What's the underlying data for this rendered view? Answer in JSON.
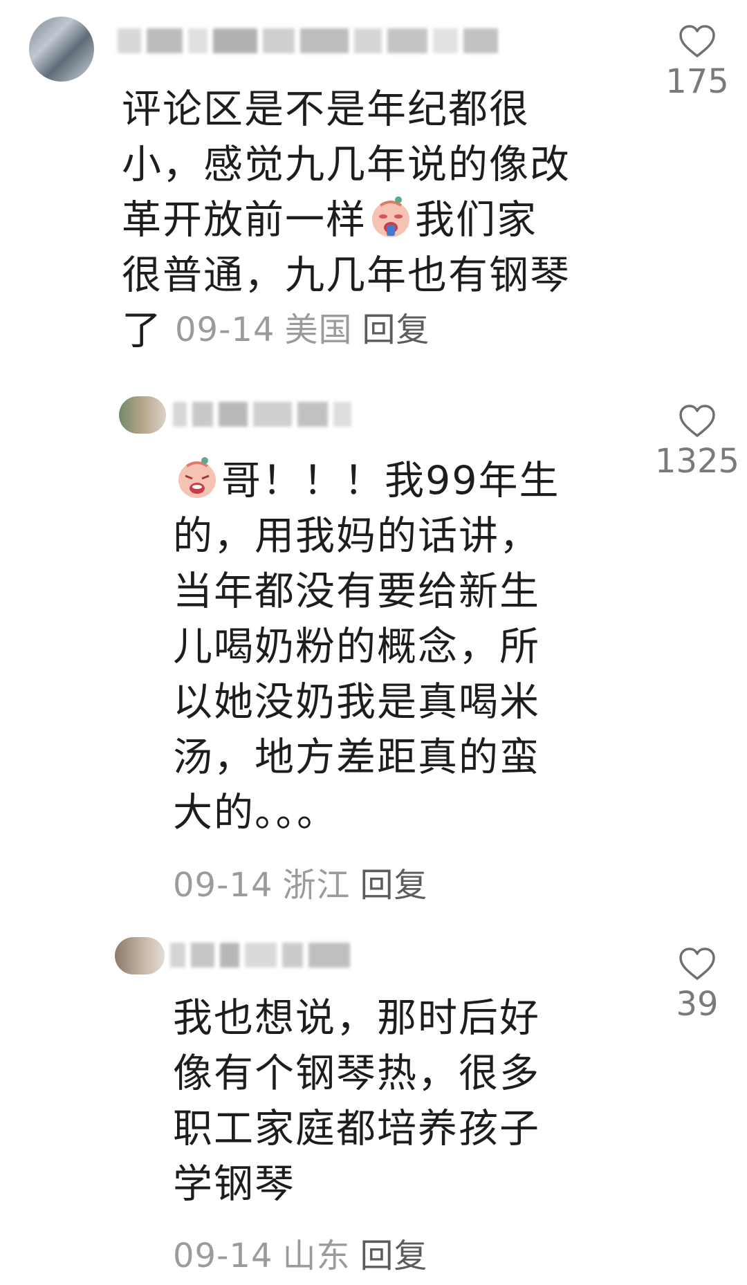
{
  "comments": [
    {
      "text_lines": [
        "评论区是不是年纪都很",
        "小，感觉九几年说的像改",
        "革开放前一样",
        "我们家",
        "很普通，九几年也有钢琴",
        "了"
      ],
      "date": "09-14",
      "location": "美国",
      "reply_label": "回复",
      "likes": "175",
      "emoji_icon": "crying-face-emoji-icon"
    },
    {
      "text_lines": [
        "哥！！！我99年生",
        "的，用我妈的话讲，",
        "当年都没有要给新生",
        "儿喝奶粉的概念，所",
        "以她没奶我是真喝米",
        "汤，地方差距真的蛮",
        "大的。。。"
      ],
      "date": "09-14",
      "location": "浙江",
      "reply_label": "回复",
      "likes": "1325",
      "emoji_icon": "crying-face-emoji-icon"
    },
    {
      "text_lines": [
        "我也想说，那时后好",
        "像有个钢琴热，很多",
        "职工家庭都培养孩子",
        "学钢琴"
      ],
      "date": "09-14",
      "location": "山东",
      "reply_label": "回复",
      "likes": "39"
    }
  ],
  "colors": {
    "text": "#1d1d1d",
    "meta": "#9b9b9b",
    "reply": "#5c5c5c",
    "like_count": "#7a7a7a",
    "heart_stroke": "#6f6f6f"
  }
}
